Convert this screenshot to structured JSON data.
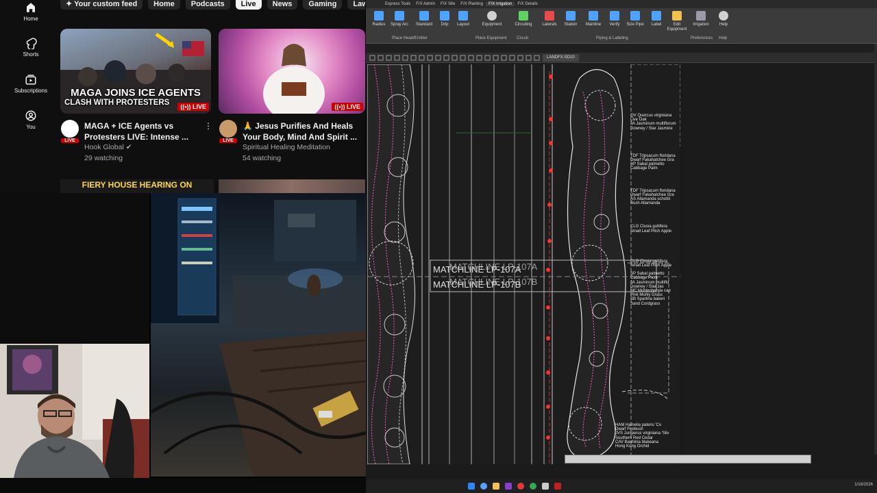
{
  "youtube": {
    "rail": [
      {
        "label": "Home",
        "icon": "home-icon"
      },
      {
        "label": "Shorts",
        "icon": "shorts-icon"
      },
      {
        "label": "Subscriptions",
        "icon": "subscriptions-icon"
      },
      {
        "label": "You",
        "icon": "you-icon"
      }
    ],
    "chips": [
      "Your custom feed",
      "Home",
      "Podcasts",
      "Live",
      "News",
      "Gaming",
      "Law enfo"
    ],
    "active_chip": "Live",
    "videos": [
      {
        "thumb_title_1": "MAGA JOINS ICE AGENTS",
        "thumb_title_2": "CLASH WITH PROTESTERS",
        "live_badge": "LIVE",
        "title": "MAGA + ICE Agents vs Protesters LIVE: Intense ...",
        "channel": "Hook Global",
        "watching": "29 watching",
        "avatar_live": "LIVE"
      },
      {
        "live_badge": "LIVE",
        "title": "🙏 Jesus Purifies And Heals Your Body, Mind And Spirit ...",
        "channel": "Spiritual Healing Meditation",
        "watching": "54 watching",
        "avatar_live": "LIVE"
      }
    ],
    "next_thumb_title": "FIERY HOUSE HEARING ON"
  },
  "cad": {
    "tabs": [
      "Express Tools",
      "F/X Admin",
      "F/X Site",
      "F/X Planting",
      "F/X Irrigation",
      "F/X Details"
    ],
    "active_tab": "F/X Irrigation",
    "tools": [
      {
        "label": "Radius",
        "color": "#4da3ff"
      },
      {
        "label": "Spray Arc",
        "color": "#4da3ff"
      },
      {
        "label": "Standard",
        "color": "#4da3ff"
      },
      {
        "label": "Drip",
        "color": "#4da3ff"
      },
      {
        "label": "Layout",
        "color": "#4da3ff"
      },
      {
        "label": "Equipment",
        "color": "#d0d0d0"
      },
      {
        "label": "Circuiting",
        "color": "#5fd35f"
      },
      {
        "label": "Laterals",
        "color": "#e94b4b"
      },
      {
        "label": "Station",
        "color": "#4da3ff"
      },
      {
        "label": "Mainline",
        "color": "#4da3ff"
      },
      {
        "label": "Verify",
        "color": "#4da3ff"
      },
      {
        "label": "Size Pipe",
        "color": "#4da3ff"
      },
      {
        "label": "Label",
        "color": "#4da3ff"
      },
      {
        "label": "Edit Equipment",
        "color": "#f2c14e"
      },
      {
        "label": "Irrigation",
        "color": "#9a9aa8"
      },
      {
        "label": "Help",
        "color": "#d0d0d0"
      }
    ],
    "groups": [
      "Place Head/Emitter",
      "Place Equipment",
      "Circuit",
      "Piping & Labeling",
      "Preferences",
      "Help"
    ],
    "file_tab": "LANDFX-SD10",
    "matchlines": [
      "MATCHLINE LP-107A",
      "MATCHLINE LP-107B"
    ],
    "plant_labels": [
      "QV Quercus virginiana",
      "Live Oak",
      "JA Jasminum multiflorum",
      "Downey / Star Jasmine",
      "TDF Tripsacum floridana",
      "Dwarf Fakahatchee Gra",
      "SP Sabal palmetto",
      "Cabbage Palm",
      "TDF Tripsacum floridana",
      "Dwarf Fakahatchee Gra",
      "AS Allamanda schottii",
      "Bush Allamanda",
      "CLG Clusia guttifera",
      "Small Leaf Pitch Apple",
      "CLG Clusia guttifera",
      "Small Leaf Pitch Apple",
      "SP Sabal palmetto",
      "Cabbage Palm",
      "JA Jasminum multiflo",
      "Downey / Star Jas",
      "MC Muhlenbergia cap",
      "Pink Muhly Grass",
      "SB Spartina bakeri",
      "Sand Cordgrass",
      "HAM Hamelia patens 'Co",
      "Dwarf Firebush",
      "JVS Juniperus virginiana 'Silv",
      "Southern Red Cedar",
      "CAV Bauhinia blakeana",
      "Hong Kong Orchid"
    ],
    "tray_time": "1/18/2026"
  }
}
